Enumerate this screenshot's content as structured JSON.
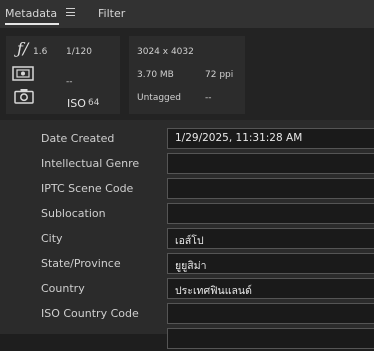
{
  "tabs": [
    {
      "label": "Metadata",
      "active": true
    },
    {
      "label": "Filter",
      "active": false
    }
  ],
  "summary": {
    "aperture": "1.6",
    "shutter_speed": "1/120",
    "exposure_comp": "--",
    "iso_label": "ISO",
    "iso_value": "64",
    "dimensions": "3024 x 4032",
    "file_size": "3.70 MB",
    "resolution": "72 ppi",
    "color_profile": "Untagged",
    "bit_depth": "--"
  },
  "fields": [
    {
      "label": "Date Created",
      "value": "1/29/2025, 11:31:28 AM"
    },
    {
      "label": "Intellectual Genre",
      "value": ""
    },
    {
      "label": "IPTC Scene Code",
      "value": ""
    },
    {
      "label": "Sublocation",
      "value": ""
    },
    {
      "label": "City",
      "value": "เอส์โป"
    },
    {
      "label": "State/Province",
      "value": "ยูยูสิม่า"
    },
    {
      "label": "Country",
      "value": "ประเทศฟินแลนด์"
    },
    {
      "label": "ISO Country Code",
      "value": ""
    }
  ],
  "colors": {
    "background": "#1e1e1e",
    "panel": "#2b2b2b",
    "card": "#2c2c2c",
    "input": "#1a1a1a"
  },
  "icons": [
    "aperture-f-icon",
    "metering-mode-icon",
    "camera-icon",
    "menu-icon"
  ]
}
